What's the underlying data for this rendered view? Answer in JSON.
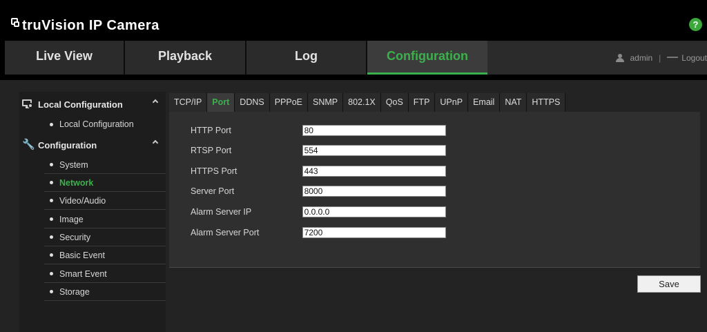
{
  "app": {
    "title": "truVision  IP Camera",
    "help_label": "?"
  },
  "topnav": {
    "tabs": [
      {
        "label": "Live View"
      },
      {
        "label": "Playback"
      },
      {
        "label": "Log"
      },
      {
        "label": "Configuration"
      }
    ],
    "active_tab": "Configuration",
    "user": "admin",
    "separator": "|",
    "logout_label": "Logout"
  },
  "sidebar": {
    "sections": [
      {
        "label": "Local Configuration",
        "icon": "monitor-settings-icon",
        "expanded": true,
        "items": [
          {
            "label": "Local Configuration"
          }
        ]
      },
      {
        "label": "Configuration",
        "icon": "wrench-icon",
        "expanded": true,
        "items": [
          {
            "label": "System"
          },
          {
            "label": "Network"
          },
          {
            "label": "Video/Audio"
          },
          {
            "label": "Image"
          },
          {
            "label": "Security"
          },
          {
            "label": "Basic Event"
          },
          {
            "label": "Smart Event"
          },
          {
            "label": "Storage"
          }
        ]
      }
    ],
    "active_item": "Network"
  },
  "subtabs": {
    "items": [
      {
        "label": "TCP/IP"
      },
      {
        "label": "Port"
      },
      {
        "label": "DDNS"
      },
      {
        "label": "PPPoE"
      },
      {
        "label": "SNMP"
      },
      {
        "label": "802.1X"
      },
      {
        "label": "QoS"
      },
      {
        "label": "FTP"
      },
      {
        "label": "UPnP"
      },
      {
        "label": "Email"
      },
      {
        "label": "NAT"
      },
      {
        "label": "HTTPS"
      }
    ],
    "active": "Port"
  },
  "form": {
    "fields": [
      {
        "label": "HTTP Port",
        "value": "80"
      },
      {
        "label": "RTSP Port",
        "value": "554"
      },
      {
        "label": "HTTPS Port",
        "value": "443"
      },
      {
        "label": "Server Port",
        "value": "8000"
      },
      {
        "label": "Alarm Server IP",
        "value": "0.0.0.0"
      },
      {
        "label": "Alarm Server Port",
        "value": "7200"
      }
    ],
    "save_label": "Save"
  },
  "colors": {
    "accent": "#3cb04c",
    "help": "#3aa83a",
    "background": "#000000"
  }
}
